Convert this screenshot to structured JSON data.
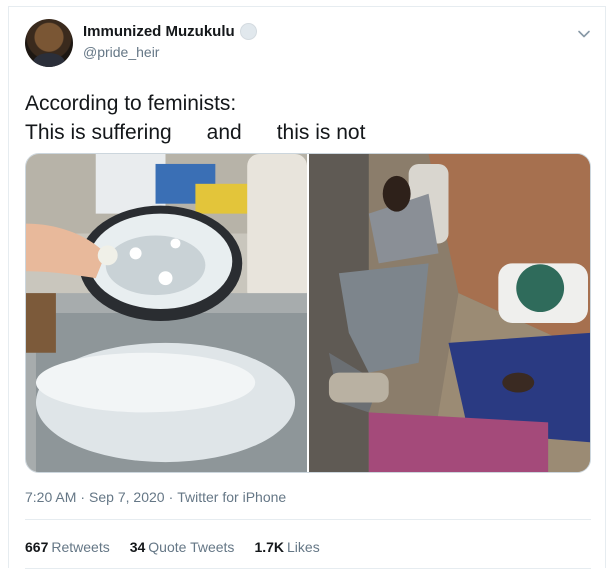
{
  "tweet": {
    "display_name": "Immunized Muzukulu",
    "handle": "@pride_heir",
    "text_line1": "According to feminists:",
    "text_line2": "This is suffering      and      this is not",
    "time": "7:20 AM",
    "sep1": "·",
    "date": "Sep 7, 2020",
    "sep2": "·",
    "source": "Twitter for iPhone"
  },
  "stats": [
    {
      "count": "667",
      "label": "Retweets"
    },
    {
      "count": "34",
      "label": "Quote Tweets"
    },
    {
      "count": "1.7K",
      "label": "Likes"
    }
  ],
  "icons": {
    "avatar": "avatar",
    "verified": "badge-icon",
    "menu": "chevron-down-icon"
  },
  "colors": {
    "text": "#14171a",
    "secondary": "#657786",
    "border": "#e6ecf0"
  }
}
